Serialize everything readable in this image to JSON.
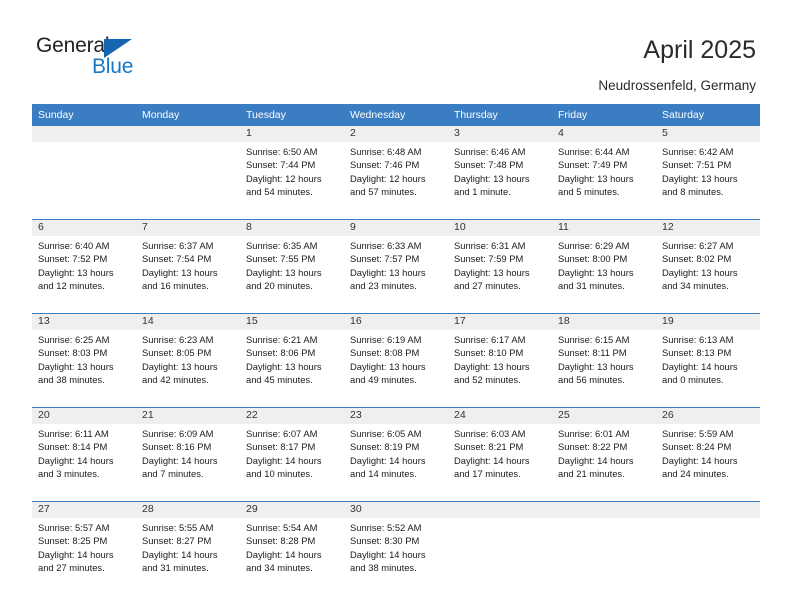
{
  "brand": {
    "name_part1": "General",
    "name_part2": "Blue",
    "triangle_color": "#1565b0",
    "blue_color": "#1878c8"
  },
  "header": {
    "title": "April 2025",
    "subtitle": "Neudrossenfeld, Germany"
  },
  "calendar": {
    "header_bg": "#3a7dc2",
    "band_bg": "#efefef",
    "weekdays": [
      "Sunday",
      "Monday",
      "Tuesday",
      "Wednesday",
      "Thursday",
      "Friday",
      "Saturday"
    ],
    "weeks": [
      [
        {
          "day": "",
          "detail": ""
        },
        {
          "day": "",
          "detail": ""
        },
        {
          "day": "1",
          "detail": "Sunrise: 6:50 AM\nSunset: 7:44 PM\nDaylight: 12 hours\nand 54 minutes."
        },
        {
          "day": "2",
          "detail": "Sunrise: 6:48 AM\nSunset: 7:46 PM\nDaylight: 12 hours\nand 57 minutes."
        },
        {
          "day": "3",
          "detail": "Sunrise: 6:46 AM\nSunset: 7:48 PM\nDaylight: 13 hours\nand 1 minute."
        },
        {
          "day": "4",
          "detail": "Sunrise: 6:44 AM\nSunset: 7:49 PM\nDaylight: 13 hours\nand 5 minutes."
        },
        {
          "day": "5",
          "detail": "Sunrise: 6:42 AM\nSunset: 7:51 PM\nDaylight: 13 hours\nand 8 minutes."
        }
      ],
      [
        {
          "day": "6",
          "detail": "Sunrise: 6:40 AM\nSunset: 7:52 PM\nDaylight: 13 hours\nand 12 minutes."
        },
        {
          "day": "7",
          "detail": "Sunrise: 6:37 AM\nSunset: 7:54 PM\nDaylight: 13 hours\nand 16 minutes."
        },
        {
          "day": "8",
          "detail": "Sunrise: 6:35 AM\nSunset: 7:55 PM\nDaylight: 13 hours\nand 20 minutes."
        },
        {
          "day": "9",
          "detail": "Sunrise: 6:33 AM\nSunset: 7:57 PM\nDaylight: 13 hours\nand 23 minutes."
        },
        {
          "day": "10",
          "detail": "Sunrise: 6:31 AM\nSunset: 7:59 PM\nDaylight: 13 hours\nand 27 minutes."
        },
        {
          "day": "11",
          "detail": "Sunrise: 6:29 AM\nSunset: 8:00 PM\nDaylight: 13 hours\nand 31 minutes."
        },
        {
          "day": "12",
          "detail": "Sunrise: 6:27 AM\nSunset: 8:02 PM\nDaylight: 13 hours\nand 34 minutes."
        }
      ],
      [
        {
          "day": "13",
          "detail": "Sunrise: 6:25 AM\nSunset: 8:03 PM\nDaylight: 13 hours\nand 38 minutes."
        },
        {
          "day": "14",
          "detail": "Sunrise: 6:23 AM\nSunset: 8:05 PM\nDaylight: 13 hours\nand 42 minutes."
        },
        {
          "day": "15",
          "detail": "Sunrise: 6:21 AM\nSunset: 8:06 PM\nDaylight: 13 hours\nand 45 minutes."
        },
        {
          "day": "16",
          "detail": "Sunrise: 6:19 AM\nSunset: 8:08 PM\nDaylight: 13 hours\nand 49 minutes."
        },
        {
          "day": "17",
          "detail": "Sunrise: 6:17 AM\nSunset: 8:10 PM\nDaylight: 13 hours\nand 52 minutes."
        },
        {
          "day": "18",
          "detail": "Sunrise: 6:15 AM\nSunset: 8:11 PM\nDaylight: 13 hours\nand 56 minutes."
        },
        {
          "day": "19",
          "detail": "Sunrise: 6:13 AM\nSunset: 8:13 PM\nDaylight: 14 hours\nand 0 minutes."
        }
      ],
      [
        {
          "day": "20",
          "detail": "Sunrise: 6:11 AM\nSunset: 8:14 PM\nDaylight: 14 hours\nand 3 minutes."
        },
        {
          "day": "21",
          "detail": "Sunrise: 6:09 AM\nSunset: 8:16 PM\nDaylight: 14 hours\nand 7 minutes."
        },
        {
          "day": "22",
          "detail": "Sunrise: 6:07 AM\nSunset: 8:17 PM\nDaylight: 14 hours\nand 10 minutes."
        },
        {
          "day": "23",
          "detail": "Sunrise: 6:05 AM\nSunset: 8:19 PM\nDaylight: 14 hours\nand 14 minutes."
        },
        {
          "day": "24",
          "detail": "Sunrise: 6:03 AM\nSunset: 8:21 PM\nDaylight: 14 hours\nand 17 minutes."
        },
        {
          "day": "25",
          "detail": "Sunrise: 6:01 AM\nSunset: 8:22 PM\nDaylight: 14 hours\nand 21 minutes."
        },
        {
          "day": "26",
          "detail": "Sunrise: 5:59 AM\nSunset: 8:24 PM\nDaylight: 14 hours\nand 24 minutes."
        }
      ],
      [
        {
          "day": "27",
          "detail": "Sunrise: 5:57 AM\nSunset: 8:25 PM\nDaylight: 14 hours\nand 27 minutes."
        },
        {
          "day": "28",
          "detail": "Sunrise: 5:55 AM\nSunset: 8:27 PM\nDaylight: 14 hours\nand 31 minutes."
        },
        {
          "day": "29",
          "detail": "Sunrise: 5:54 AM\nSunset: 8:28 PM\nDaylight: 14 hours\nand 34 minutes."
        },
        {
          "day": "30",
          "detail": "Sunrise: 5:52 AM\nSunset: 8:30 PM\nDaylight: 14 hours\nand 38 minutes."
        },
        {
          "day": "",
          "detail": ""
        },
        {
          "day": "",
          "detail": ""
        },
        {
          "day": "",
          "detail": ""
        }
      ]
    ]
  }
}
